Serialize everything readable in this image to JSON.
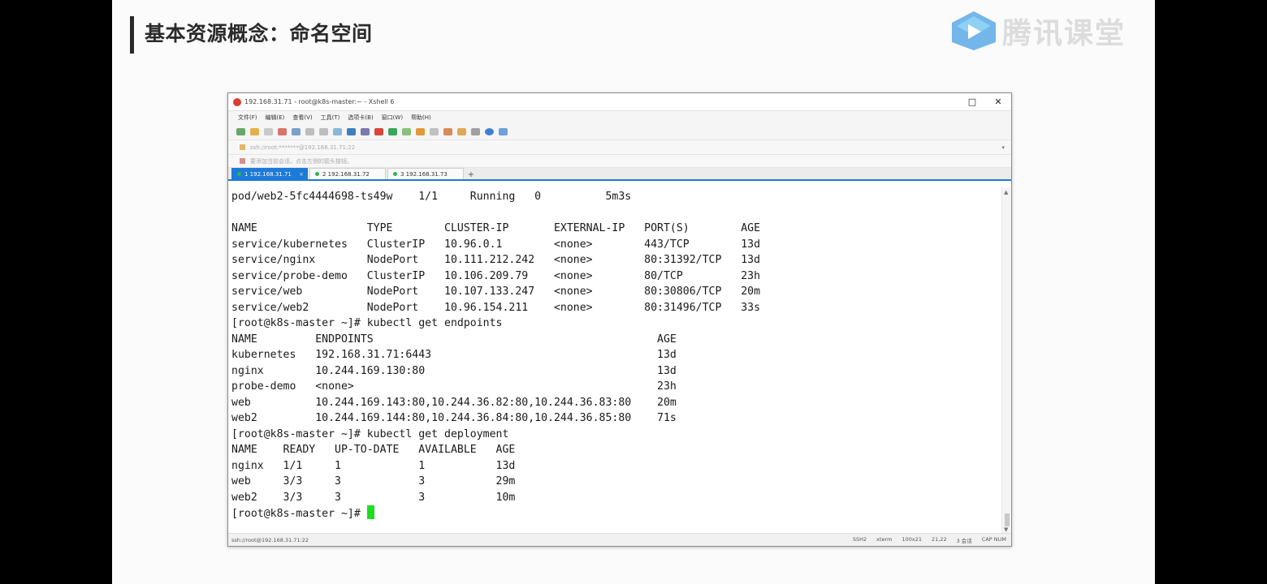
{
  "slide": {
    "title": "基本资源概念：命名空间",
    "logo_text": "腾讯课堂"
  },
  "window": {
    "title": "192.168.31.71 - root@k8s-master:~ - Xshell 6",
    "minimize": "□",
    "close": "✕",
    "menu": [
      "文件(F)",
      "编辑(E)",
      "查看(V)",
      "工具(T)",
      "选项卡(B)",
      "窗口(W)",
      "帮助(H)"
    ],
    "address": "ssh://root:*******@192.168.31.71:22",
    "info_text": "要添加当前会话，点击左侧的箭头按钮。",
    "tabs": [
      {
        "label": "1 192.168.31.71",
        "active": true
      },
      {
        "label": "2 192.168.31.72",
        "active": false
      },
      {
        "label": "3 192.168.31.73",
        "active": false
      }
    ],
    "tab_add": "+",
    "status_left": "ssh://root@192.168.31.71:22",
    "status_right": [
      "SSH2",
      "xterm",
      "100x21",
      "21,22",
      "3 会话",
      "CAP NUM"
    ]
  },
  "terminal": {
    "lines": [
      "pod/web2-5fc4444698-ts49w    1/1     Running   0          5m3s",
      "",
      "NAME                 TYPE        CLUSTER-IP       EXTERNAL-IP   PORT(S)        AGE",
      "service/kubernetes   ClusterIP   10.96.0.1        <none>        443/TCP        13d",
      "service/nginx        NodePort    10.111.212.242   <none>        80:31392/TCP   13d",
      "service/probe-demo   ClusterIP   10.106.209.79    <none>        80/TCP         23h",
      "service/web          NodePort    10.107.133.247   <none>        80:30806/TCP   20m",
      "service/web2         NodePort    10.96.154.211    <none>        80:31496/TCP   33s",
      "[root@k8s-master ~]# kubectl get endpoints",
      "NAME         ENDPOINTS                                            AGE",
      "kubernetes   192.168.31.71:6443                                   13d",
      "nginx        10.244.169.130:80                                    13d",
      "probe-demo   <none>                                               23h",
      "web          10.244.169.143:80,10.244.36.82:80,10.244.36.83:80    20m",
      "web2         10.244.169.144:80,10.244.36.84:80,10.244.36.85:80    71s",
      "[root@k8s-master ~]# kubectl get deployment",
      "NAME    READY   UP-TO-DATE   AVAILABLE   AGE",
      "nginx   1/1     1            1           13d",
      "web     3/3     3            3           29m",
      "web2    3/3     3            3           10m"
    ],
    "prompt": "[root@k8s-master ~]# "
  }
}
